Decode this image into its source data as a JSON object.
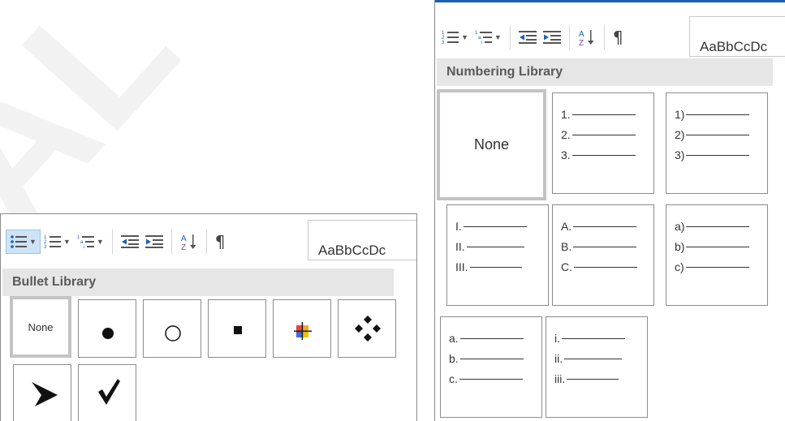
{
  "bullet_panel": {
    "header": "Bullet Library",
    "styles_preview": "AaBbCcDc",
    "none_label": "None",
    "items": [
      {
        "icon": "none"
      },
      {
        "icon": "filled-circle-icon"
      },
      {
        "icon": "hollow-circle-icon"
      },
      {
        "icon": "filled-square-icon"
      },
      {
        "icon": "colored-square-icon"
      },
      {
        "icon": "diamond-cluster-icon"
      },
      {
        "icon": "arrowhead-icon"
      },
      {
        "icon": "checkmark-icon"
      }
    ]
  },
  "number_panel": {
    "header": "Numbering Library",
    "styles_preview": "AaBbCcDc",
    "none_label": "None",
    "formats": [
      {
        "lines": [
          "1.",
          "2.",
          "3."
        ]
      },
      {
        "lines": [
          "1)",
          "2)",
          "3)"
        ]
      },
      {
        "lines": [
          "I.",
          "II.",
          "III."
        ]
      },
      {
        "lines": [
          "A.",
          "B.",
          "C."
        ]
      },
      {
        "lines": [
          "a)",
          "b)",
          "c)"
        ]
      },
      {
        "lines": [
          "a.",
          "b.",
          "c."
        ]
      },
      {
        "lines": [
          "i.",
          "ii.",
          "iii."
        ]
      }
    ]
  },
  "colors": {
    "selected_border": "#c3c3c3",
    "header_bg": "#e6e6e6",
    "accent_blue": "#1a5fb4",
    "sort_purple": "#7d3fa0"
  }
}
